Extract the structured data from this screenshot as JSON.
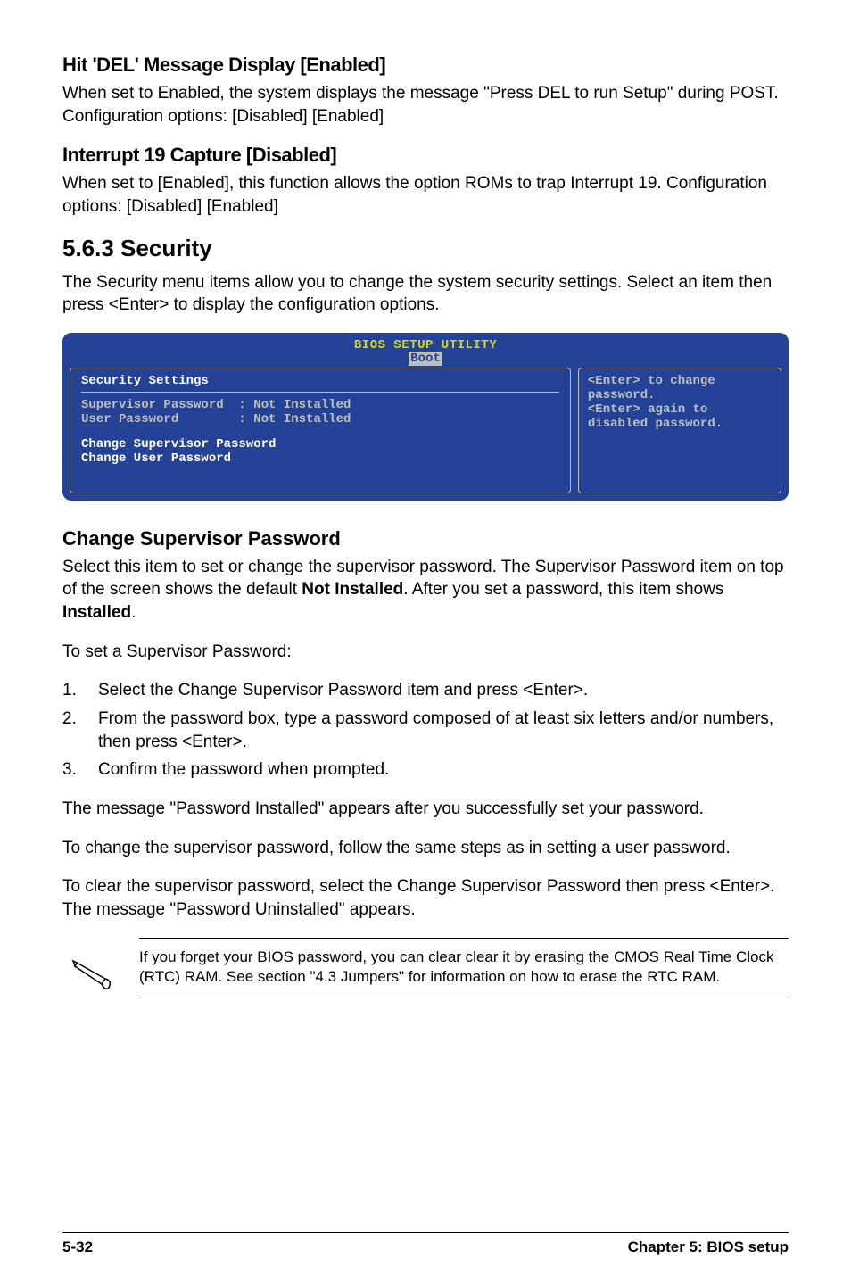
{
  "section1": {
    "heading": "Hit 'DEL' Message Display [Enabled]",
    "body": "When set to Enabled, the system displays the message \"Press DEL to run Setup\" during POST. Configuration options: [Disabled] [Enabled]"
  },
  "section2": {
    "heading": "Interrupt 19 Capture [Disabled]",
    "body": "When set to [Enabled], this function allows the option ROMs to trap Interrupt 19. Configuration options: [Disabled] [Enabled]"
  },
  "section563": {
    "heading": "5.6.3   Security",
    "intro": "The Security menu items allow you to change the system security settings. Select an item then press <Enter> to display the configuration options."
  },
  "bios": {
    "title": "BIOS SETUP UTILITY",
    "tab": "Boot",
    "left_title": "Security Settings",
    "line1": "Supervisor Password  : Not Installed",
    "line2": "User Password        : Not Installed",
    "action1": "Change Supervisor Password",
    "action2": "Change User Password",
    "help1": "<Enter> to change",
    "help2": "password.",
    "help3": "<Enter> again to",
    "help4": "disabled password."
  },
  "change_sup": {
    "heading": "Change Supervisor Password",
    "p1a": "Select this item to set or change the supervisor password. The Supervisor Password item on top of the screen shows the default ",
    "p1b": "Not Installed",
    "p1c": ". After you set a password, this item shows ",
    "p1d": "Installed",
    "p1e": ".",
    "p2": "To set a Supervisor Password:",
    "steps": [
      {
        "num": "1.",
        "text": "Select the Change Supervisor Password item and press <Enter>."
      },
      {
        "num": "2.",
        "text": "From the password box, type a password composed of at least six letters and/or numbers, then press <Enter>."
      },
      {
        "num": "3.",
        "text": "Confirm the password when prompted."
      }
    ],
    "p3": "The message \"Password Installed\" appears after you successfully set your password.",
    "p4": "To change the supervisor password, follow the same steps as in setting a user password.",
    "p5": "To clear the supervisor password, select the Change Supervisor Password then press <Enter>. The message \"Password Uninstalled\" appears."
  },
  "note": {
    "text": "If you forget your BIOS password, you can clear clear it by erasing the CMOS Real Time Clock (RTC) RAM. See section \"4.3  Jumpers\" for information on how to erase the RTC RAM."
  },
  "footer": {
    "left": "5-32",
    "right": "Chapter 5: BIOS setup"
  }
}
